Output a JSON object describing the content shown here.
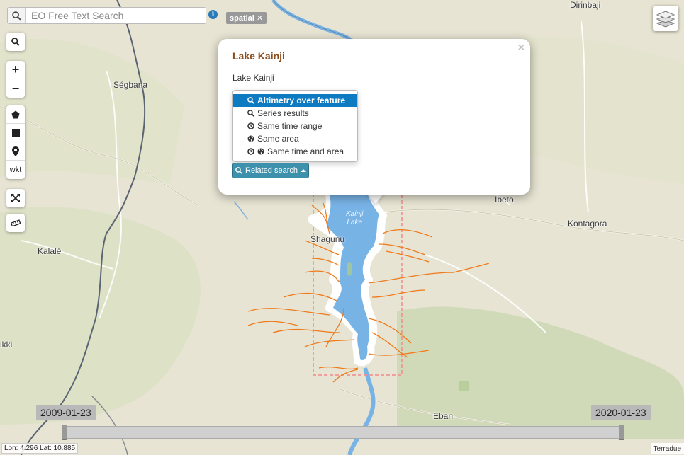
{
  "search": {
    "placeholder": "EO Free Text Search"
  },
  "filter_tag": {
    "label": "spatial",
    "close": "✕"
  },
  "toolbar": {
    "search_icon": "search-icon",
    "zoom_in": "+",
    "zoom_out": "−",
    "wkt": "wkt"
  },
  "places": {
    "segbana": "Ségbana",
    "kalale": "Kalalé",
    "ikki": "ikki",
    "dirinbaji": "Dirinbaji",
    "ibeto": "Ibeto",
    "kontagora": "Kontagora",
    "shagunu": "Shagunu",
    "eban": "Eban",
    "kainji_lake_1": "Kainji",
    "kainji_lake_2": "Lake"
  },
  "popup": {
    "title": "Lake Kainji",
    "description": "Lake Kainji",
    "close": "×",
    "menu_items": [
      {
        "label": "Altimetry over feature",
        "icons": "search-icon",
        "active": true
      },
      {
        "label": "Series results",
        "icons": "search-icon",
        "active": false
      },
      {
        "label": "Same time range",
        "icons": "clock-icon",
        "active": false
      },
      {
        "label": "Same area",
        "icons": "globe-icon",
        "active": false
      },
      {
        "label": "Same time and area",
        "icons": "clock-icon globe-icon",
        "active": false
      }
    ],
    "related_button": "Related search"
  },
  "timeline": {
    "start": "2009-01-23",
    "end": "2020-01-23"
  },
  "coords": "Lon: 4.296 Lat: 10.885",
  "attribution": "Terradue",
  "colors": {
    "land": "#e7e4d3",
    "water": "#78b3e6",
    "river": "#f07a1a",
    "border": "#5b6473",
    "accent": "#0d7ac2",
    "title": "#8b4f1f"
  }
}
